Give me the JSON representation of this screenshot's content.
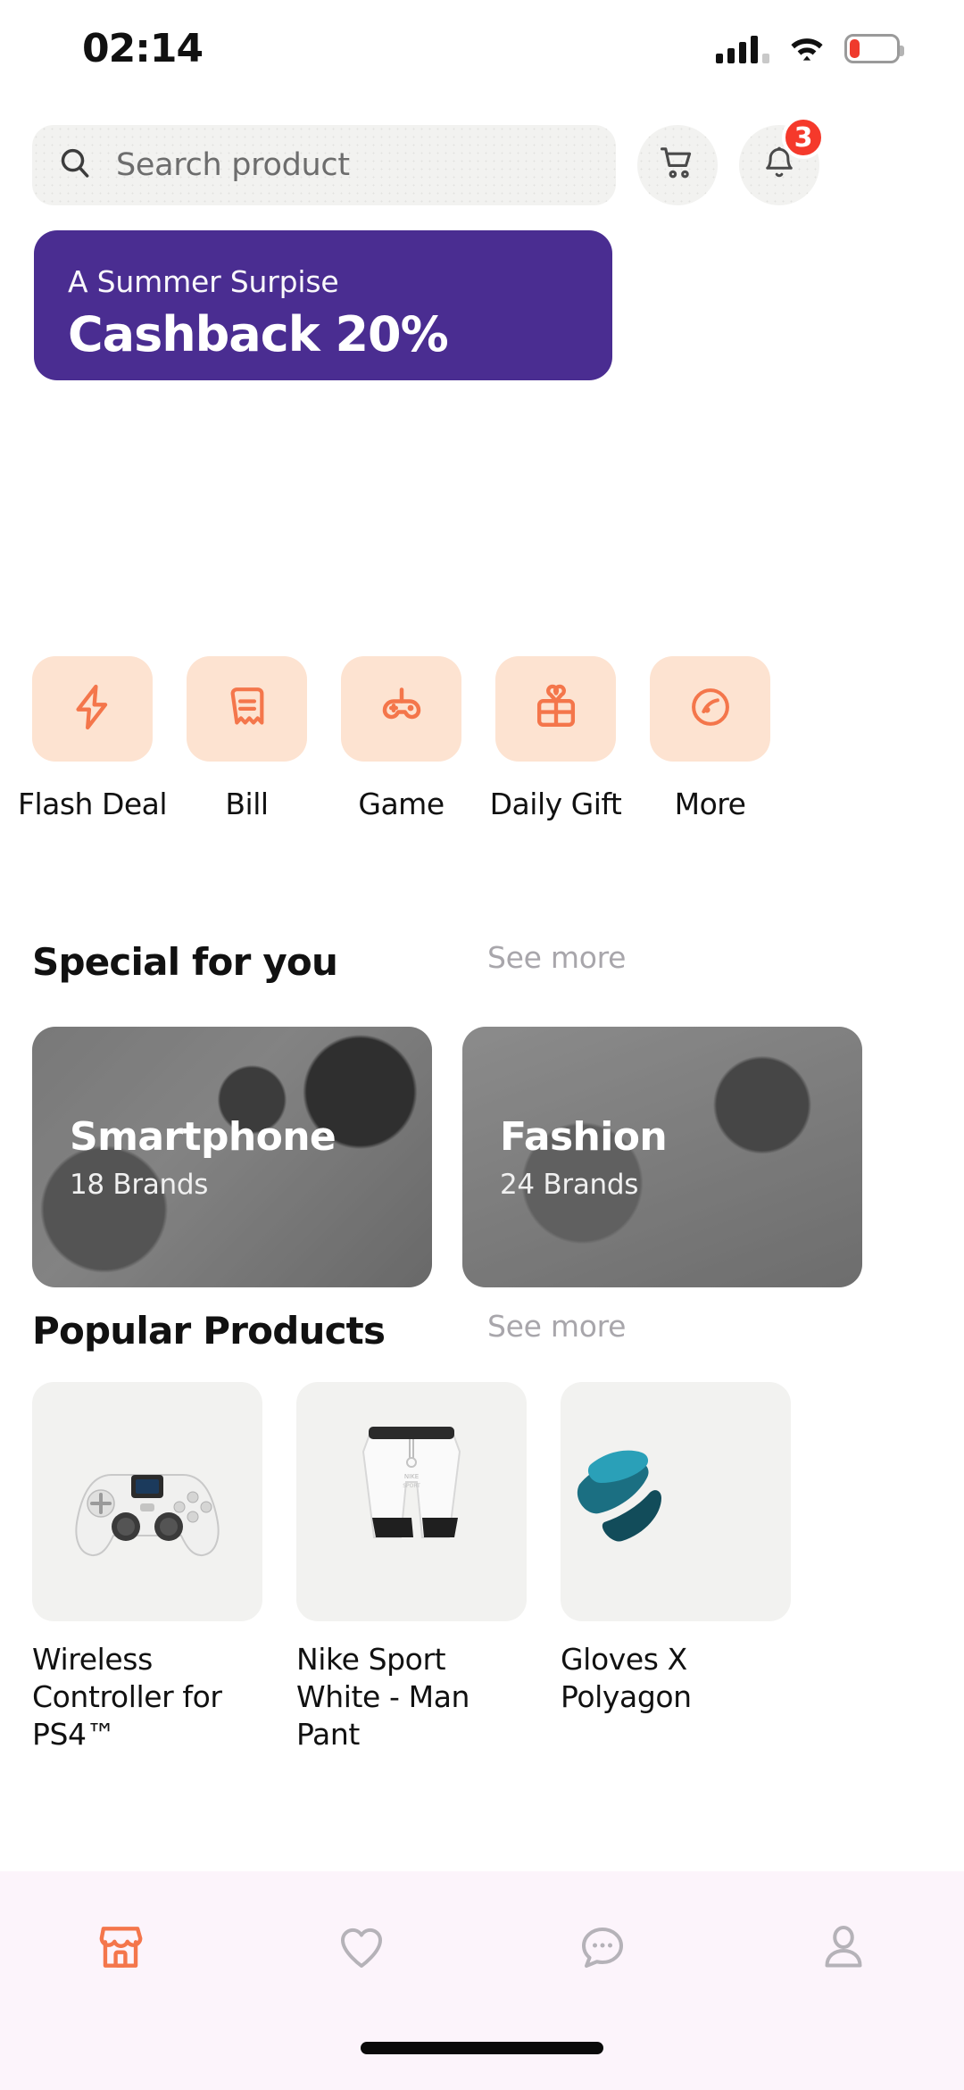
{
  "status_bar": {
    "time": "02:14",
    "signal_icon": "cellular-signal-icon",
    "wifi_icon": "wifi-icon",
    "battery_icon": "battery-low-icon",
    "battery_color": "#ef3a2d"
  },
  "header": {
    "search": {
      "placeholder": "Search product",
      "value": "",
      "icon": "search-icon"
    },
    "cart": {
      "icon": "shopping-cart-icon"
    },
    "notification": {
      "icon": "bell-icon",
      "badge": "3",
      "badge_color": "#f5392b"
    }
  },
  "banner": {
    "subtitle": "A Summer Surpise",
    "title": "Cashback 20%",
    "bg_color": "#4a2d91"
  },
  "categories": {
    "accent_color": "#f4764b",
    "tile_color": "#fde3d1",
    "items": [
      {
        "label": "Flash Deal",
        "icon": "lightning-bolt-icon"
      },
      {
        "label": "Bill",
        "icon": "receipt-icon"
      },
      {
        "label": "Game",
        "icon": "gamepad-icon"
      },
      {
        "label": "Daily Gift",
        "icon": "gift-icon"
      },
      {
        "label": "More",
        "icon": "more-circle-icon"
      }
    ]
  },
  "special_section": {
    "title": "Special for you",
    "see_more": "See more",
    "cards": [
      {
        "name": "Smartphone",
        "brands": "18 Brands"
      },
      {
        "name": "Fashion",
        "brands": "24 Brands"
      }
    ]
  },
  "popular_section": {
    "title": "Popular Products",
    "see_more": "See more",
    "products": [
      {
        "name": "Wireless Controller for PS4™"
      },
      {
        "name": "Nike Sport White - Man Pant"
      },
      {
        "name": "Gloves X Polyagon"
      }
    ]
  },
  "bottom_nav": {
    "active_color": "#f4764b",
    "inactive_color": "#b5b2b8",
    "items": [
      {
        "icon": "store-icon",
        "active": true
      },
      {
        "icon": "heart-icon",
        "active": false
      },
      {
        "icon": "chat-bubble-icon",
        "active": false
      },
      {
        "icon": "user-profile-icon",
        "active": false
      }
    ]
  }
}
